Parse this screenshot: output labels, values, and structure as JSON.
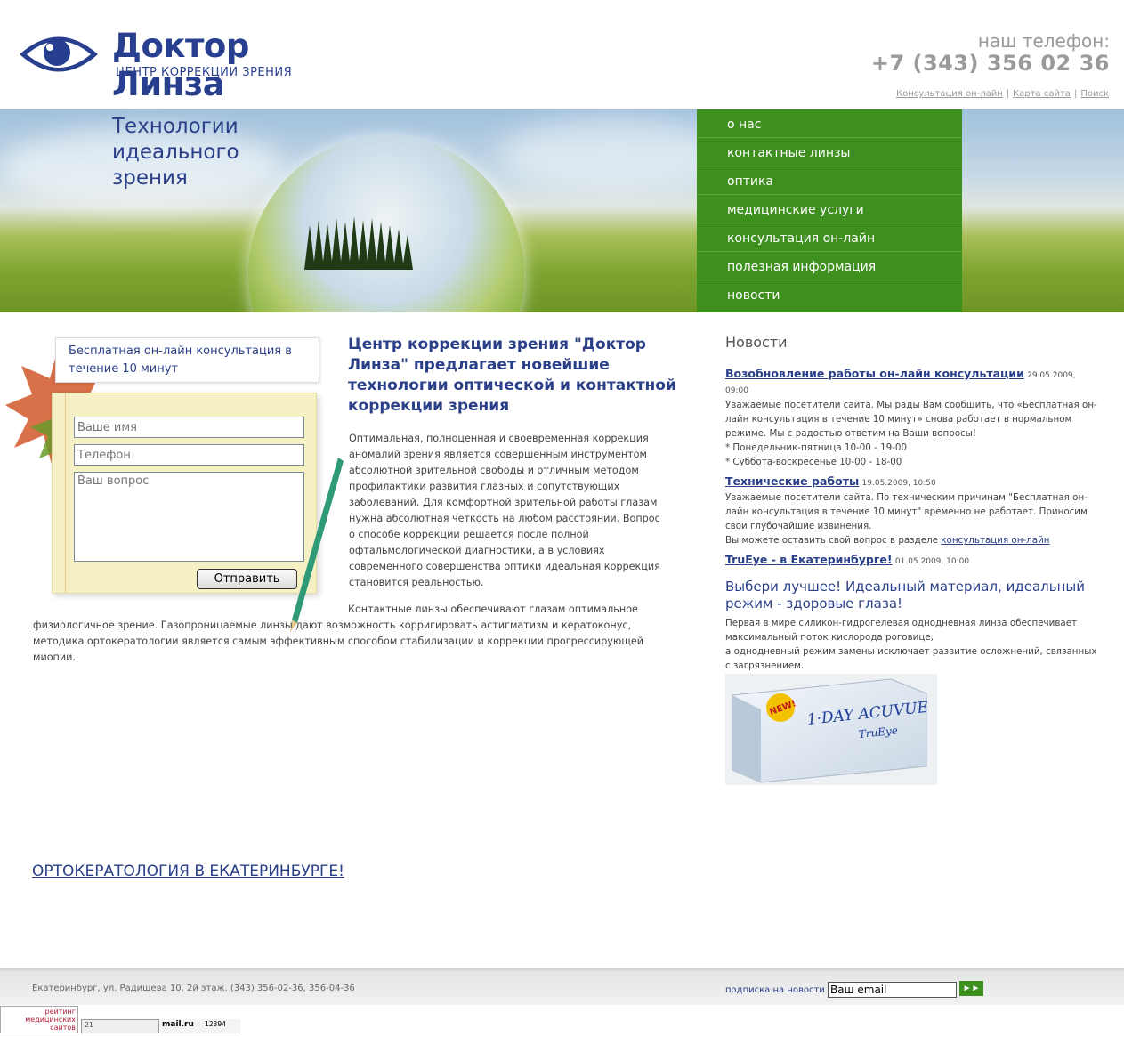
{
  "header": {
    "logo_title": "Доктор Линза",
    "logo_sub": "ЦЕНТР КОРРЕКЦИИ ЗРЕНИЯ",
    "phone_label": "наш телефон:",
    "phone_number": "+7 (343) 356 02 36",
    "links": [
      "Консультация он-лайн",
      "Карта сайта",
      "Поиск"
    ],
    "link_sep": "|"
  },
  "banner": {
    "title_lines": [
      "Технологии",
      "идеального",
      "зрения"
    ]
  },
  "nav": {
    "items": [
      "о нас",
      "контактные линзы",
      "оптика",
      "медицинские услуги",
      "консультация он-лайн",
      "полезная информация",
      "новости"
    ]
  },
  "consult": {
    "title": "Бесплатная он-лайн консультация в течение 10 минут",
    "name_placeholder": "Ваше имя",
    "phone_placeholder": "Телефон",
    "question_placeholder": "Ваш вопрос",
    "send_label": "Отправить"
  },
  "intro": {
    "title": "Центр коррекции зрения \"Доктор Линза\" предлагает новейшие технологии оптической и контактной коррекции зрения",
    "p1": "Оптимальная, полноценная и своевременная коррекция аномалий зрения является совершенным инструментом абсолютной зрительной свободы и отличным методом профилактики развития глазных и сопутствующих заболеваний. Для комфортной зрительной работы глазам нужна абсолютная чёткость на любом расстоянии. Вопрос о способе коррекции решается после полной офтальмологической диагностики, а в условиях современного совершенства оптики идеальная коррекция становится реальностью.",
    "p2": "Контактные линзы обеспечивают глазам оптимальное физиологичное зрение. Газопроницаемые линзы дают возможность корригировать астигматизм и кератоконус, методика ортокератологии является самым эффективным способом стабилизации и коррекции прогрессирующей миопии.",
    "ortho_link": "ОРТОКЕРАТОЛОГИЯ В ЕКАТЕРИНБУРГЕ!"
  },
  "news": {
    "heading": "Новости",
    "items": [
      {
        "title": "Возобновление работы он-лайн консультации",
        "date": "29.05.2009, 09:00",
        "lines": [
          "Уважаемые посетители сайта. Мы рады Вам сообщить, что «Бесплатная он-лайн консультация в течение 10 минут» снова работает в нормальном режиме. Мы с радостью ответим на Ваши вопросы!",
          "* Понедельник-пятница 10-00 - 19-00",
          "* Суббота-воскресенье 10-00 - 18-00"
        ]
      },
      {
        "title": "Технические работы",
        "date": "19.05.2009, 10:50",
        "lines": [
          "Уважаемые посетители сайта. По техническим причинам \"Бесплатная он-лайн консультация в течение 10 минут\"  временно не работает. Приносим свои глубочайшие извинения."
        ],
        "tail_text": "Вы можете оставить свой вопрос в разделе ",
        "tail_link": "консультация он-лайн"
      },
      {
        "title": "TruEye - в Екатеринбурге!",
        "date": "01.05.2009, 10:00"
      }
    ]
  },
  "promo": {
    "heading": "Выбери лучшее! Идеальный материал, идеальный режим - здоровые глаза!",
    "lines": [
      "Первая в мире силикон-гидрогелевая однодневная линза обеспечивает максимальный поток кислорода роговице,",
      "а однодневный режим замены исключает развитие осложнений, связанных с загрязнением."
    ],
    "box_new": "NEW!",
    "box_brand": "1·DAY ACUVUE",
    "box_sub": "TruEye"
  },
  "footer": {
    "address": "Екатеринбург, ул. Радищева 10, 2й этаж. (343) 356-02-36, 356-04-36",
    "subscribe_label": "подписка на новости",
    "email_value": "Ваш email",
    "submit_glyph": "►►"
  },
  "counters": {
    "rating_lines": [
      "рейтинг",
      "медицинских",
      "сайтов"
    ],
    "rating_value": "21",
    "mail_label": "mail.ru",
    "mail_value": "12394"
  },
  "colors": {
    "brand_blue": "#283f8f",
    "nav_green": "#3d8f1e",
    "phone_gray": "#9a9a9a"
  }
}
